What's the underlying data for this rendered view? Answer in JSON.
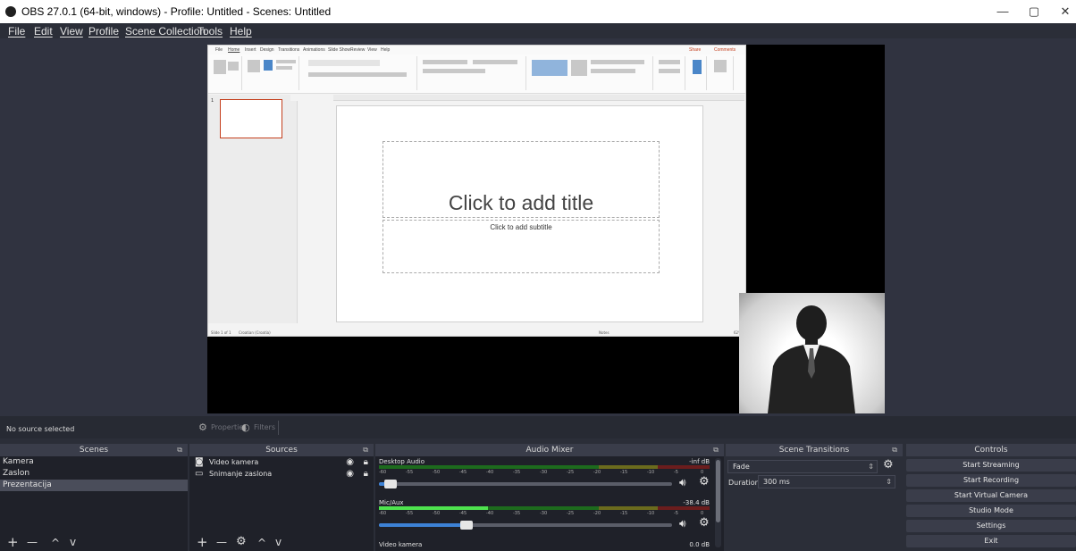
{
  "window": {
    "title": "OBS 27.0.1 (64-bit, windows) - Profile: Untitled - Scenes: Untitled",
    "minimize_glyph": "—",
    "maximize_glyph": "▢",
    "close_glyph": "✕"
  },
  "menu": [
    "File",
    "Edit",
    "View",
    "Profile",
    "Scene Collection",
    "Tools",
    "Help"
  ],
  "preview": {
    "slide_title_placeholder": "Click to add title",
    "slide_subtitle_placeholder": "Click to add subtitle",
    "slide_thumb_number": "1",
    "ppt_tabs": [
      "File",
      "Home",
      "Insert",
      "Design",
      "Transitions",
      "Animations",
      "Slide Show",
      "Review",
      "View",
      "Help"
    ],
    "ppt_share": "Share",
    "ppt_comments": "Comments",
    "ppt_status_left": "Slide 1 of 1",
    "ppt_status_lang": "Croatian (Croatia)",
    "ppt_notes": "Notes",
    "ppt_zoom": "62%"
  },
  "source_toolbar": {
    "no_source": "No source selected",
    "properties": "Properties",
    "filters": "Filters"
  },
  "scenes": {
    "header": "Scenes",
    "items": [
      "Kamera",
      "Zaslon",
      "Prezentacija"
    ],
    "selected_index": 2,
    "footer": [
      "+",
      "—",
      "^",
      "v"
    ]
  },
  "sources": {
    "header": "Sources",
    "items": [
      {
        "label": "Video kamera",
        "icon": "camera-icon"
      },
      {
        "label": "Snimanje zaslona",
        "icon": "monitor-icon"
      }
    ],
    "footer": [
      "+",
      "—",
      "⚙",
      "^",
      "v"
    ]
  },
  "audio_mixer": {
    "header": "Audio Mixer",
    "channels": [
      {
        "name": "Desktop Audio",
        "db": "-inf dB",
        "level": 0.0,
        "volume": 0.04
      },
      {
        "name": "Mic/Aux",
        "db": "-38.4 dB",
        "level": 0.33,
        "volume": 0.3
      },
      {
        "name": "Video kamera",
        "db": "0.0 dB",
        "level": 0.0,
        "volume": 1.0
      }
    ],
    "scale": [
      "-60",
      "-55",
      "-50",
      "-45",
      "-40",
      "-35",
      "-30",
      "-25",
      "-20",
      "-15",
      "-10",
      "-5",
      "0"
    ]
  },
  "scene_transitions": {
    "header": "Scene Transitions",
    "transition": "Fade",
    "duration_label": "Duration",
    "duration_value": "300 ms"
  },
  "controls": {
    "header": "Controls",
    "buttons": [
      "Start Streaming",
      "Start Recording",
      "Start Virtual Camera",
      "Studio Mode",
      "Settings",
      "Exit"
    ]
  },
  "colors": {
    "accent": "#3d82d6",
    "meter_green": "#4ee34e"
  }
}
